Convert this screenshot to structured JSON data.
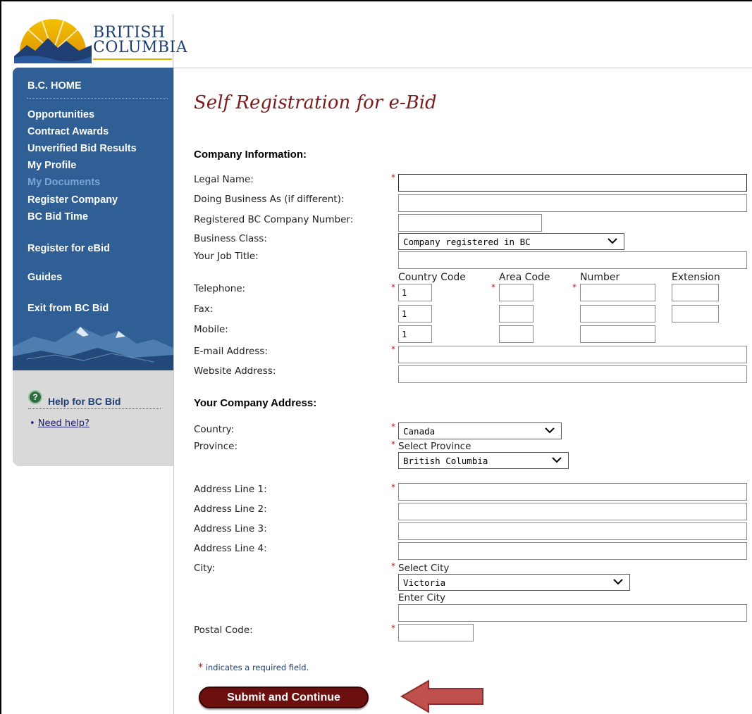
{
  "brand": {
    "line1": "BRITISH",
    "line2": "COLUMBIA"
  },
  "nav": {
    "items": [
      {
        "label": "B.C. HOME"
      },
      {
        "label": "Opportunities"
      },
      {
        "label": "Contract Awards"
      },
      {
        "label": "Unverified Bid Results"
      },
      {
        "label": "My Profile"
      },
      {
        "label": "My Documents",
        "disabled": true
      },
      {
        "label": "Register Company"
      },
      {
        "label": "BC Bid Time"
      },
      {
        "label": "Register for eBid"
      },
      {
        "label": "Guides"
      },
      {
        "label": "Exit from BC Bid"
      }
    ]
  },
  "help": {
    "icon": "question-icon",
    "icon_glyph": "?",
    "title": "Help for BC Bid",
    "bullet": "•",
    "link": "Need help?"
  },
  "page": {
    "title": "Self Registration for e-Bid"
  },
  "company": {
    "heading": "Company Information:",
    "legal_name_label": "Legal Name:",
    "dba_label": "Doing Business As (if different):",
    "bc_number_label": "Registered BC Company Number:",
    "business_class_label": "Business Class:",
    "business_class_value": "Company registered in BC",
    "job_title_label": "Your Job Title:",
    "phone_headers": {
      "country": "Country Code",
      "area": "Area Code",
      "number": "Number",
      "extension": "Extension"
    },
    "telephone_label": "Telephone:",
    "fax_label": "Fax:",
    "mobile_label": "Mobile:",
    "country_code_value": "1",
    "email_label": "E-mail Address:",
    "website_label": "Website Address:"
  },
  "address": {
    "heading": "Your Company Address:",
    "country_label": "Country:",
    "country_value": "Canada",
    "province_label": "Province:",
    "select_province": "Select Province",
    "province_value": "British Columbia",
    "line1_label": "Address Line 1:",
    "line2_label": "Address Line 2:",
    "line3_label": "Address Line 3:",
    "line4_label": "Address Line 4:",
    "city_label": "City:",
    "select_city": "Select City",
    "city_value": "Victoria",
    "enter_city": "Enter City",
    "postal_label": "Postal Code:"
  },
  "required_marker": "*",
  "required_note": "indicates a required field.",
  "submit_label": "Submit and Continue",
  "colors": {
    "nav_bg": "#2f5f95",
    "title": "#7b1c1c",
    "required": "#b21c1c",
    "submit_bg": "#6b0f0f",
    "arrow": "#c0504d"
  },
  "annotation": {
    "type": "arrow",
    "icon": "left-arrow-icon",
    "points_to": "submit"
  }
}
